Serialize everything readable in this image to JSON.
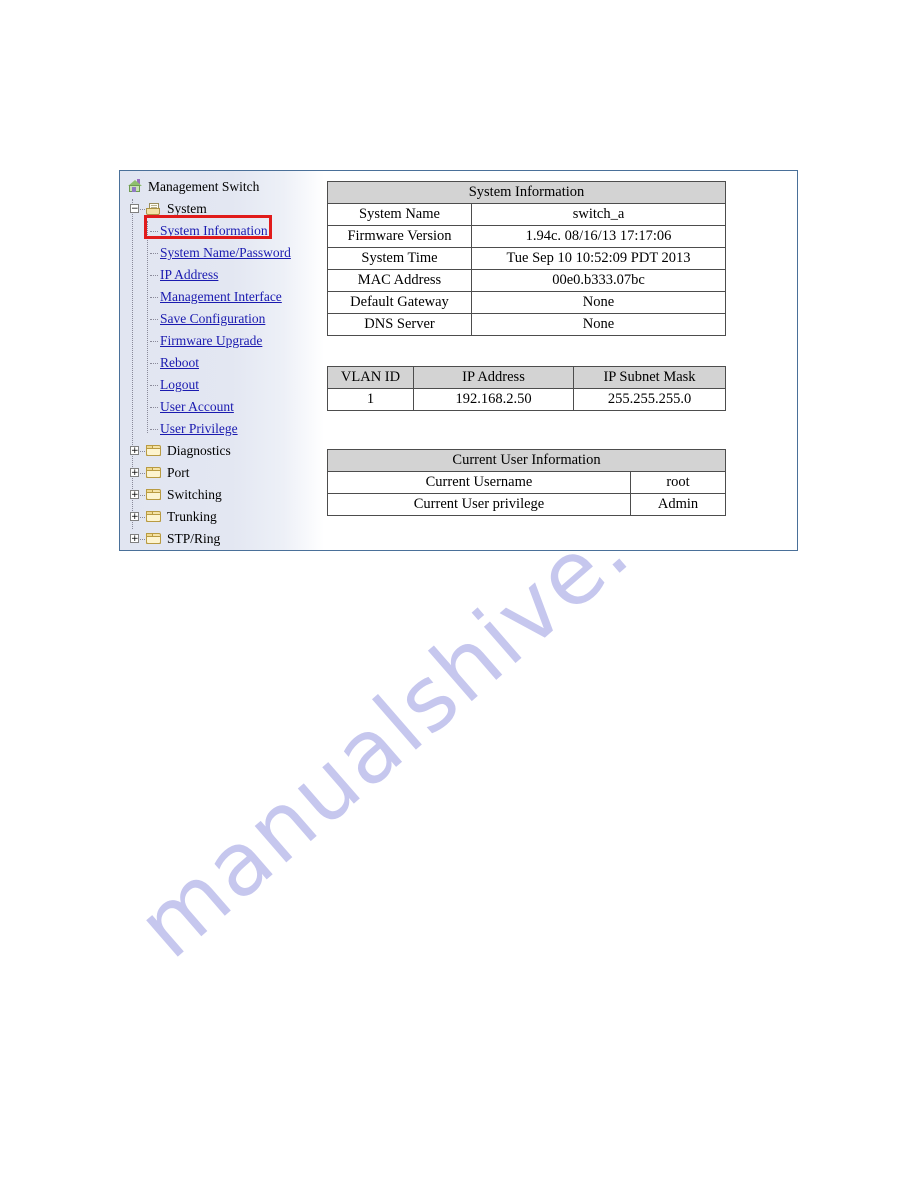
{
  "nav_tree": {
    "root": {
      "label": "Management Switch",
      "icon": "home-icon"
    },
    "system": {
      "label": "System",
      "icon": "open-folder-document-icon",
      "expander": "−"
    },
    "system_children": [
      {
        "label": "System Information",
        "selected": true
      },
      {
        "label": "System Name/Password",
        "selected": false
      },
      {
        "label": "IP Address",
        "selected": false
      },
      {
        "label": "Management Interface",
        "selected": false
      },
      {
        "label": "Save Configuration",
        "selected": false
      },
      {
        "label": "Firmware Upgrade",
        "selected": false
      },
      {
        "label": "Reboot",
        "selected": false
      },
      {
        "label": "Logout",
        "selected": false
      },
      {
        "label": "User Account",
        "selected": false
      },
      {
        "label": "User Privilege",
        "selected": false
      }
    ],
    "folders": [
      {
        "label": "Diagnostics",
        "expander": "+",
        "icon": "folder-icon"
      },
      {
        "label": "Port",
        "expander": "+",
        "icon": "folder-icon"
      },
      {
        "label": "Switching",
        "expander": "+",
        "icon": "folder-icon"
      },
      {
        "label": "Trunking",
        "expander": "+",
        "icon": "folder-icon"
      },
      {
        "label": "STP/Ring",
        "expander": "+",
        "icon": "folder-icon"
      }
    ],
    "selection_color": "#e11b1b"
  },
  "system_information": {
    "title": "System Information",
    "rows": [
      {
        "label": "System Name",
        "value": "switch_a"
      },
      {
        "label": "Firmware Version",
        "value": "1.94c. 08/16/13 17:17:06"
      },
      {
        "label": "System Time",
        "value": "Tue Sep 10 10:52:09 PDT 2013"
      },
      {
        "label": "MAC Address",
        "value": "00e0.b333.07bc"
      },
      {
        "label": "Default Gateway",
        "value": "None"
      },
      {
        "label": "DNS Server",
        "value": "None"
      }
    ]
  },
  "vlan_table": {
    "headers": [
      "VLAN ID",
      "IP Address",
      "IP Subnet Mask"
    ],
    "rows": [
      [
        "1",
        "192.168.2.50",
        "255.255.255.0"
      ]
    ]
  },
  "current_user_information": {
    "title": "Current User Information",
    "rows": [
      {
        "label": "Current Username",
        "value": "root"
      },
      {
        "label": "Current User privilege",
        "value": "Admin"
      }
    ]
  },
  "watermark": {
    "text": "manualshive.com",
    "color": "#c6c7ee"
  }
}
